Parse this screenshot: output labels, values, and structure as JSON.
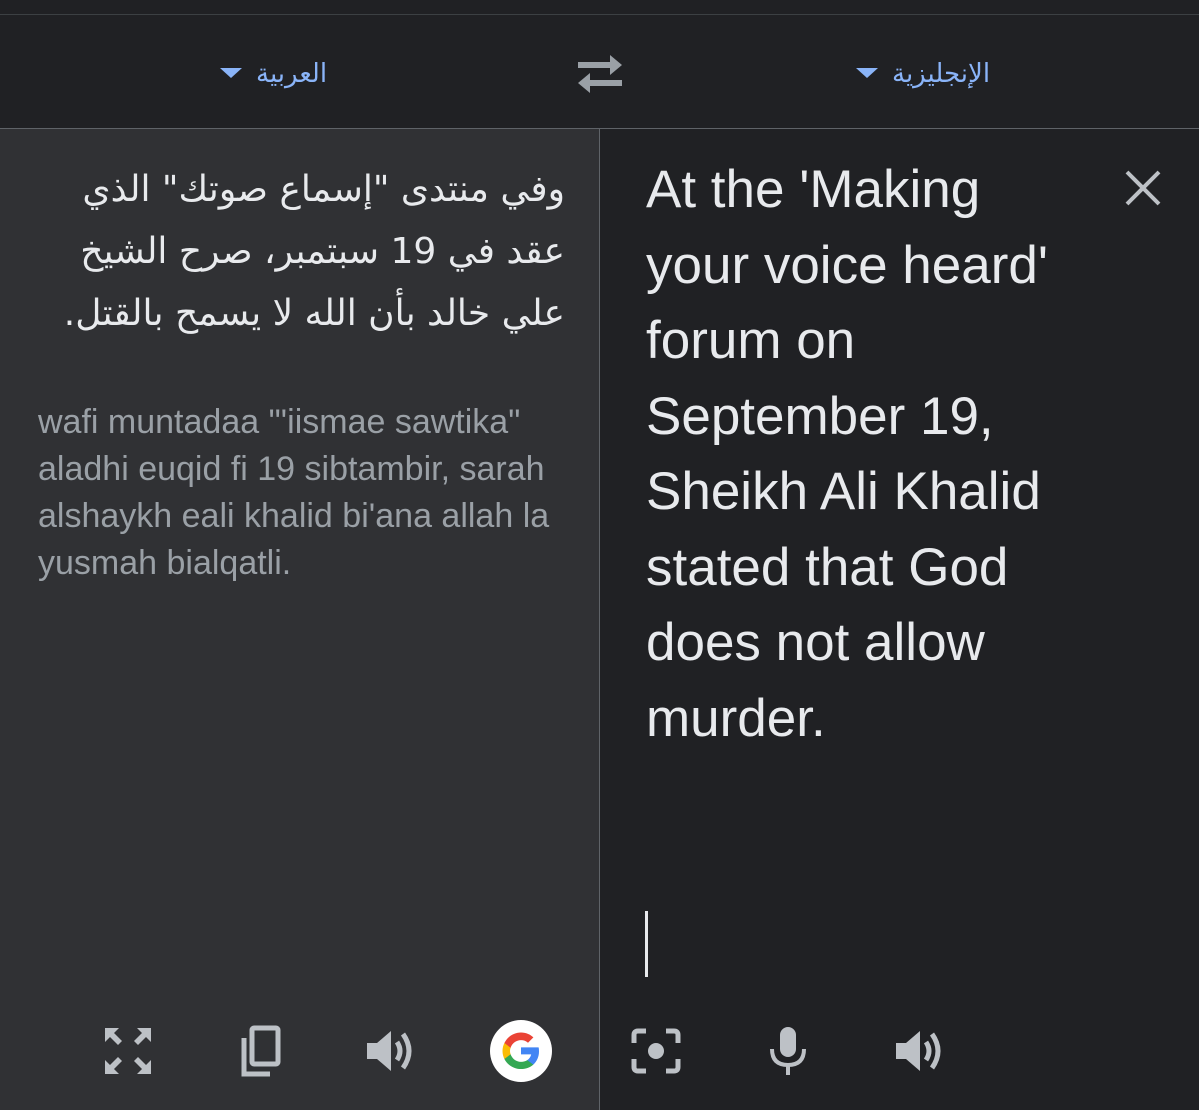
{
  "languages": {
    "source": "العربية",
    "target": "الإنجليزية"
  },
  "source": {
    "text": "وفي منتدى \"إسماع صوتك\" الذي عقد في 19 سبتمبر، صرح الشيخ علي خالد بأن الله لا يسمح بالقتل.",
    "transliteration": "wafi muntadaa \"'iismae sawtika\" aladhi euqid fi 19 sibtambir, sarah alshaykh eali khalid bi'ana allah la yusmah bialqatli."
  },
  "target": {
    "text": "At the 'Making your voice heard' forum on September 19, Sheikh Ali Khalid stated that God does not allow murder."
  },
  "icons": {
    "swap": "swap-languages-icon",
    "close": "close-icon",
    "fullscreen": "fullscreen-icon",
    "copy": "copy-icon",
    "speaker": "speaker-icon",
    "google": "google-g-icon",
    "camera": "camera-icon",
    "mic": "microphone-icon"
  },
  "colors": {
    "accent": "#8ab4f8",
    "text_primary": "#e8eaed",
    "text_secondary": "#9aa0a6",
    "panel_left": "#303134",
    "panel_right": "#202124"
  }
}
